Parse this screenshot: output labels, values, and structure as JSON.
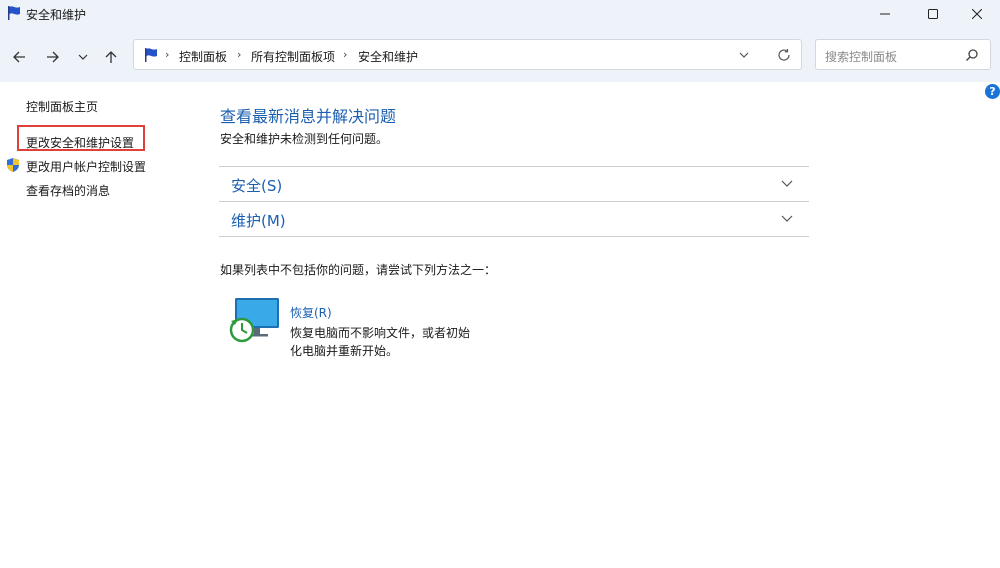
{
  "window": {
    "title": "安全和维护",
    "controls": [
      "minimize-icon",
      "maximize-icon",
      "close-icon"
    ]
  },
  "nav": {
    "back_icon": "arrow-left-icon",
    "forward_icon": "arrow-right-icon",
    "recent_icon": "chevron-down-icon",
    "up_icon": "arrow-up-icon"
  },
  "address": {
    "icon": "flag-icon",
    "crumbs": [
      "控制面板",
      "所有控制面板项",
      "安全和维护"
    ],
    "separator": "›"
  },
  "search": {
    "placeholder": "搜索控制面板",
    "icon": "search-icon"
  },
  "help": {
    "label": "?"
  },
  "sidebar": {
    "items": [
      {
        "label": "控制面板主页"
      },
      {
        "label": "更改安全和维护设置",
        "highlighted": true
      },
      {
        "label": "更改用户帐户控制设置",
        "icon": "shield-icon"
      },
      {
        "label": "查看存档的消息"
      }
    ]
  },
  "main": {
    "title": "查看最新消息并解决问题",
    "subtitle": "安全和维护未检测到任何问题。",
    "sections": [
      {
        "label": "安全(S)"
      },
      {
        "label": "维护(M)"
      }
    ],
    "hint": "如果列表中不包括你的问题，请尝试下列方法之一：",
    "recovery": {
      "link": "恢复(R)",
      "description": "恢复电脑而不影响文件，或者初始化电脑并重新开始。"
    }
  },
  "colors": {
    "link_blue": "#1c5fb0",
    "titlebar_bg": "#eef2f9",
    "highlight_red": "#e0403a"
  }
}
